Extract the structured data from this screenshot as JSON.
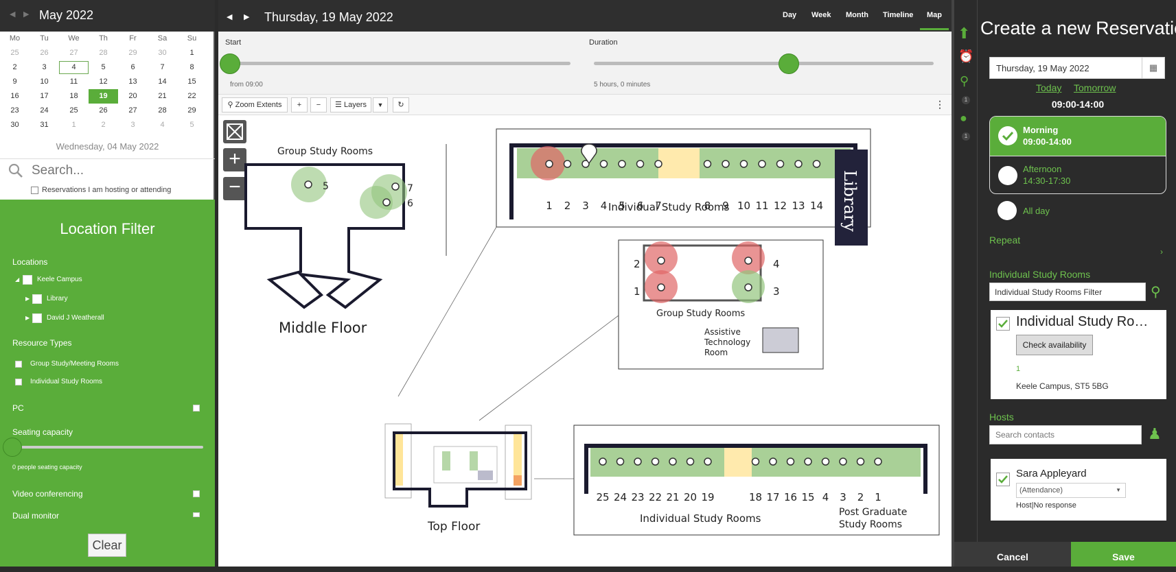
{
  "calendar": {
    "title": "May 2022",
    "weekdays": [
      "Mo",
      "Tu",
      "We",
      "Th",
      "Fr",
      "Sa",
      "Su"
    ],
    "weeks": [
      [
        "25",
        "26",
        "27",
        "28",
        "29",
        "30",
        "1"
      ],
      [
        "2",
        "3",
        "4",
        "5",
        "6",
        "7",
        "8"
      ],
      [
        "9",
        "10",
        "11",
        "12",
        "13",
        "14",
        "15"
      ],
      [
        "16",
        "17",
        "18",
        "19",
        "20",
        "21",
        "22"
      ],
      [
        "23",
        "24",
        "25",
        "26",
        "27",
        "28",
        "29"
      ],
      [
        "30",
        "31",
        "1",
        "2",
        "3",
        "4",
        "5"
      ]
    ],
    "selected_text": "Wednesday, 04 May 2022"
  },
  "search": {
    "placeholder": "Search...",
    "hosting_label": "Reservations I am hosting or attending"
  },
  "filter": {
    "title": "Location Filter",
    "locations_label": "Locations",
    "locations": [
      "Keele Campus",
      "Library",
      "David J Weatherall"
    ],
    "resource_types_label": "Resource Types",
    "resource_types": [
      "Group Study/Meeting Rooms",
      "Individual Study Rooms"
    ],
    "pc_label": "PC",
    "seating_label": "Seating capacity",
    "seating_value_text": "0 people seating capacity",
    "video_label": "Video conferencing",
    "dual_label": "Dual monitor",
    "clear_label": "Clear"
  },
  "center": {
    "date_title": "Thursday, 19 May 2022",
    "views": [
      "Day",
      "Week",
      "Month",
      "Timeline",
      "Map"
    ],
    "start_label": "Start",
    "start_sub": "from 09:00",
    "duration_label": "Duration",
    "duration_sub": "5 hours, 0 minutes",
    "zoom_extents": "Zoom Extents",
    "layers": "Layers"
  },
  "map": {
    "middle_group_label": "Group Study Rooms",
    "middle_floor_label": "Middle Floor",
    "top_floor_label": "Top Floor",
    "library_label": "Library",
    "indiv_top_label": "Individual Study Rooms",
    "indiv_top_nums": [
      "1",
      "2",
      "3",
      "4",
      "5",
      "6",
      "7",
      "8",
      "9",
      "10",
      "11",
      "12",
      "13",
      "14"
    ],
    "group_mid_label": "Group Study Rooms",
    "group_mid_nums": [
      "2",
      "1",
      "4",
      "3"
    ],
    "assistive_label": [
      "Assistive",
      "Technology",
      "Room"
    ],
    "indiv_bottom_label": "Individual Study Rooms",
    "indiv_bottom_nums": [
      "25",
      "24",
      "23",
      "22",
      "21",
      "20",
      "19",
      "18",
      "17",
      "16",
      "15",
      "4",
      "3",
      "2",
      "1"
    ],
    "postgrad_label": [
      "Post Graduate",
      "Study Rooms"
    ],
    "middle_nums": [
      "5",
      "7",
      "6"
    ]
  },
  "reservation": {
    "title": "Create a new Reservation",
    "date_value": "Thursday, 19 May 2022",
    "today": "Today",
    "tomorrow": "Tomorrow",
    "time_range": "09:00-14:00",
    "morning_label": "Morning",
    "morning_time": "09:00-14:00",
    "afternoon_label": "Afternoon",
    "afternoon_time": "14:30-17:30",
    "allday_label": "All day",
    "repeat_label": "Repeat",
    "rooms_label": "Individual Study Rooms",
    "rooms_filter_value": "Individual Study Rooms Filter",
    "room_card_title": "Individual Study Ro…",
    "check_avail": "Check availability",
    "room_count": "1",
    "room_address": "Keele Campus, ST5 5BG",
    "hosts_label": "Hosts",
    "hosts_placeholder": "Search contacts",
    "host_name": "Sara Appleyard",
    "host_attendance": "(Attendance)",
    "host_status": "Host|No response",
    "iconbar_badge_1": "1",
    "iconbar_badge_2": "1",
    "cancel": "Cancel",
    "save": "Save"
  },
  "colors": {
    "accent_green": "#5aad3a",
    "dark_bg": "#2b2b2b",
    "busy_red": "#e06666",
    "free_green": "#93c47d"
  }
}
